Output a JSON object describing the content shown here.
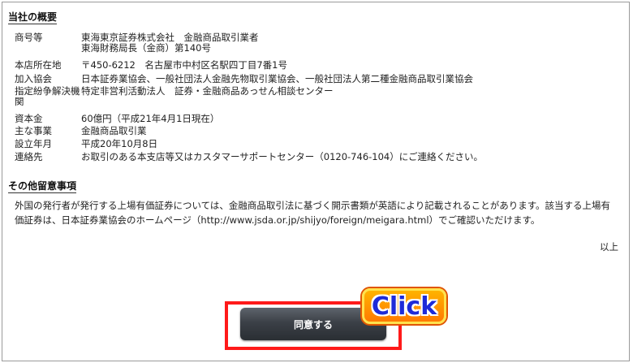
{
  "company_overview": {
    "title": "当社の概要",
    "rows": [
      {
        "label": "商号等",
        "lines": [
          "東海東京証券株式会社　金融商品取引業者",
          "東海財務局長（金商）第140号"
        ]
      },
      {
        "label": "本店所在地",
        "lines": [
          "〒450-6212　名古屋市中村区名駅四丁目7番1号"
        ]
      },
      {
        "label": "加入協会",
        "lines": [
          "日本証券業協会、一般社団法人金融先物取引業協会、一般社団法人第二種金融商品取引業協会"
        ]
      },
      {
        "label": "指定紛争解決機関",
        "lines": [
          "特定非営利活動法人　証券・金融商品あっせん相談センター"
        ]
      },
      {
        "label": "資本金",
        "lines": [
          "60億円（平成21年4月1日現在）"
        ]
      },
      {
        "label": "主な事業",
        "lines": [
          "金融商品取引業"
        ]
      },
      {
        "label": "設立年月",
        "lines": [
          "平成20年10月8日"
        ]
      },
      {
        "label": "連絡先",
        "lines": [
          "お取引のある本支店等又はカスタマーサポートセンター（0120-746-104）にご連絡ください。"
        ]
      }
    ]
  },
  "other_notes": {
    "title": "その他留意事項",
    "body": "外国の発行者が発行する上場有価証券については、金融商品取引法に基づく開示書類が英語により記載されることがあります。該当する上場有価証券は、日本証券業協会のホームページ（http://www.jsda.or.jp/shijyo/foreign/meigara.html）でご確認いただけます。",
    "end": "以上"
  },
  "agree_button": {
    "label": "同意する",
    "chevron": "›"
  },
  "click_badge": {
    "text": "Click"
  },
  "colors": {
    "highlight": "#ff1a1a",
    "badge": "#ff8c00",
    "badge_text": "#1e2bd8",
    "button": "#3b4047"
  }
}
